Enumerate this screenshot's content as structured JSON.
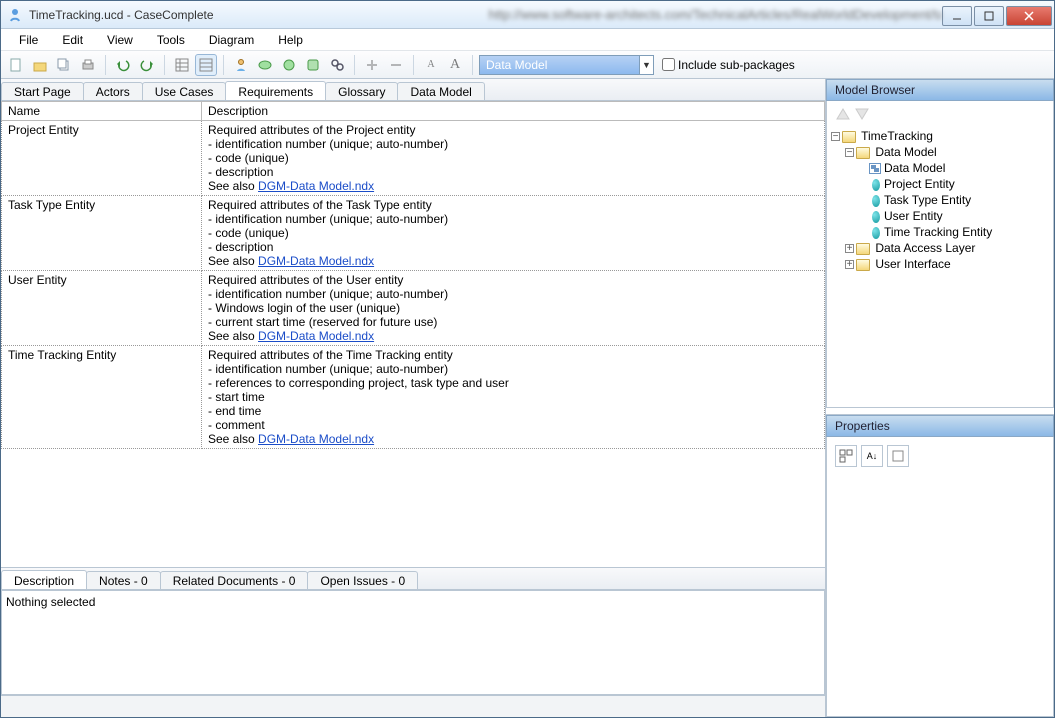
{
  "window": {
    "title": "TimeTracking.ucd - CaseComplete",
    "url_blur": "http://www.software-architects.com/TechnicalArticles/RealWorldDevelopment/tabid/81/default.aspx?language=en-US&text=new"
  },
  "menu": [
    "File",
    "Edit",
    "View",
    "Tools",
    "Diagram",
    "Help"
  ],
  "toolbar": {
    "combo_value": "Data Model",
    "include_sub": "Include sub-packages"
  },
  "tabs": {
    "items": [
      "Start Page",
      "Actors",
      "Use Cases",
      "Requirements",
      "Glossary",
      "Data Model"
    ],
    "active_index": 3
  },
  "table": {
    "headers": [
      "Name",
      "Description"
    ],
    "rows": [
      {
        "name": "Project Entity",
        "desc_lines": [
          "Required attributes of the Project entity",
          "- identification number (unique; auto-number)",
          "- code (unique)",
          "- description"
        ],
        "see_also_prefix": "See also ",
        "see_also_link": "DGM-Data Model.ndx"
      },
      {
        "name": "Task Type Entity",
        "desc_lines": [
          "Required attributes of the Task Type entity",
          "- identification number (unique; auto-number)",
          "- code (unique)",
          "- description"
        ],
        "see_also_prefix": "See also ",
        "see_also_link": "DGM-Data Model.ndx"
      },
      {
        "name": "User Entity",
        "desc_lines": [
          "Required attributes of the User entity",
          "- identification number (unique; auto-number)",
          "- Windows login of the user (unique)",
          "- current start time (reserved for future use)"
        ],
        "see_also_prefix": "See also ",
        "see_also_link": "DGM-Data Model.ndx"
      },
      {
        "name": "Time Tracking Entity",
        "desc_lines": [
          "Required attributes of the Time Tracking entity",
          "- identification number (unique; auto-number)",
          "- references to corresponding project, task type and user",
          "- start time",
          "- end time",
          "- comment"
        ],
        "see_also_prefix": "See also ",
        "see_also_link": "DGM-Data Model.ndx"
      }
    ]
  },
  "detail": {
    "tabs": [
      "Description",
      "Notes - 0",
      "Related Documents - 0",
      "Open Issues - 0"
    ],
    "active_index": 0,
    "body": "Nothing selected"
  },
  "model_browser": {
    "title": "Model Browser",
    "root": "TimeTracking",
    "data_model": {
      "label": "Data Model",
      "diagram": "Data Model",
      "entities": [
        "Project Entity",
        "Task Type Entity",
        "User Entity",
        "Time Tracking Entity"
      ]
    },
    "other_folders": [
      "Data Access Layer",
      "User Interface"
    ]
  },
  "properties": {
    "title": "Properties"
  }
}
